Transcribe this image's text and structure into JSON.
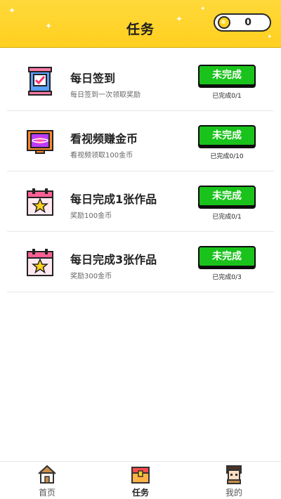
{
  "header": {
    "title": "任务",
    "coin_count": "0",
    "coin_icon": "coin-icon"
  },
  "tasks": [
    {
      "icon": "sign-in-icon",
      "name": "每日签到",
      "desc": "每日签到一次领取奖励",
      "button": "未完成",
      "progress": "已完成0/1"
    },
    {
      "icon": "tv-video-icon",
      "name": "看视频赚金币",
      "desc": "看视频领取100金币",
      "button": "未完成",
      "progress": "已完成0/10"
    },
    {
      "icon": "calendar-star-icon",
      "name": "每日完成1张作品",
      "desc": "奖励100金币",
      "button": "未完成",
      "progress": "已完成0/1"
    },
    {
      "icon": "calendar-star-icon",
      "name": "每日完成3张作品",
      "desc": "奖励300金币",
      "button": "未完成",
      "progress": "已完成0/3"
    }
  ],
  "bottom_nav": [
    {
      "icon": "home-icon",
      "label": "首页"
    },
    {
      "icon": "task-chest-icon",
      "label": "任务",
      "active": true
    },
    {
      "icon": "avatar-icon",
      "label": "我的"
    }
  ],
  "colors": {
    "header_yellow": "#ffd93a",
    "button_green": "#19c31b",
    "outline": "#0d0d0d"
  }
}
